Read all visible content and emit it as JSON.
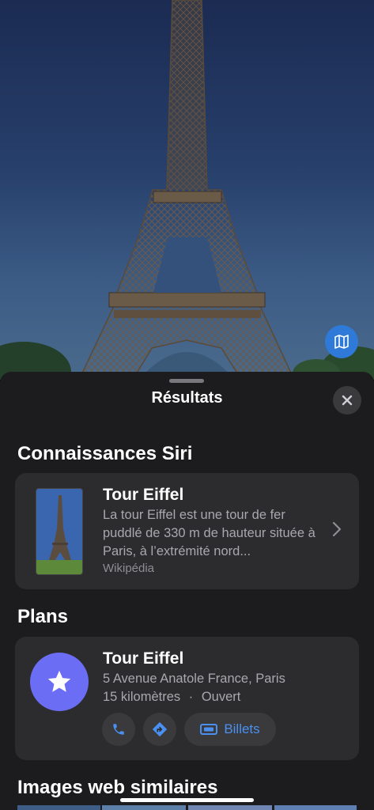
{
  "sheet": {
    "title": "Résultats"
  },
  "siri": {
    "section_title": "Connaissances Siri",
    "card_title": "Tour Eiffel",
    "description": "La tour Eiffel est une tour de fer puddlé de 330 m de hauteur située à Paris, à l’extrémité nord...",
    "source": "Wikipédia"
  },
  "plans": {
    "section_title": "Plans",
    "card_title": "Tour Eiffel",
    "address": "5 Avenue Anatole France, Paris",
    "distance": "15 kilomètres",
    "separator": "·",
    "status": "Ouvert",
    "tickets_label": "Billets"
  },
  "web": {
    "section_title": "Images web similaires"
  },
  "icons": {
    "map": "map-icon",
    "close": "close-icon",
    "chevron": "chevron-right-icon",
    "star": "star-icon",
    "phone": "phone-icon",
    "directions": "directions-icon",
    "ticket": "ticket-icon"
  },
  "colors": {
    "accent": "#4a90f0",
    "plans_badge": "#6b6ef5",
    "sheet_bg": "#1c1c1e",
    "card_bg": "#2c2c2e"
  }
}
